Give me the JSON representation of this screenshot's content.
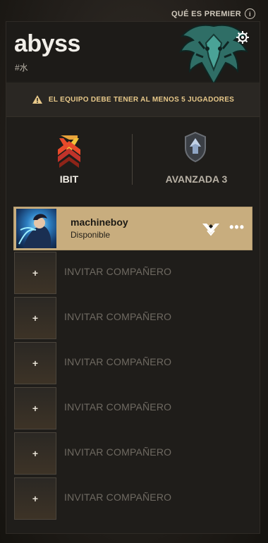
{
  "premier": {
    "label": "QUÉ ES PREMIER",
    "info_icon": "i"
  },
  "team": {
    "name": "abyss",
    "tag": "#水"
  },
  "warning": {
    "text": "EL EQUIPO DEBE TENER AL MENOS 5 JUGADORES"
  },
  "ranks": {
    "team_rank": {
      "label": "IBIT",
      "icon": "ibit-logo-icon"
    },
    "division": {
      "label": "AVANZADA 3",
      "icon": "division-shield-icon"
    }
  },
  "members": [
    {
      "name": "machineboy",
      "status": "Disponible",
      "more": "•••"
    }
  ],
  "slots": [
    {
      "plus": "+",
      "label": "INVITAR COMPAÑERO"
    },
    {
      "plus": "+",
      "label": "INVITAR COMPAÑERO"
    },
    {
      "plus": "+",
      "label": "INVITAR COMPAÑERO"
    },
    {
      "plus": "+",
      "label": "INVITAR COMPAÑERO"
    },
    {
      "plus": "+",
      "label": "INVITAR COMPAÑERO"
    },
    {
      "plus": "+",
      "label": "INVITAR COMPAÑERO"
    }
  ],
  "colors": {
    "accent_gold": "#c8ad7e",
    "warning_text": "#e8c98a",
    "background": "#1f1d1a"
  }
}
